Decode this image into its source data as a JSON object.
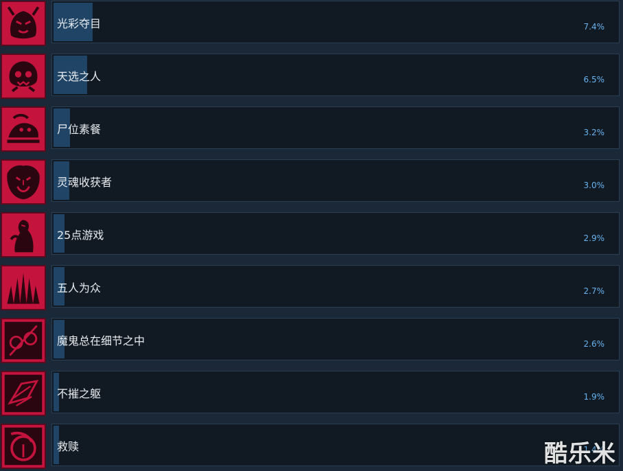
{
  "achievements": [
    {
      "name": "光彩夺目",
      "percent_label": "7.4%",
      "percent": 7.4,
      "icon": "demon-face-icon"
    },
    {
      "name": "天选之人",
      "percent_label": "6.5%",
      "percent": 6.5,
      "icon": "skull-flames-icon"
    },
    {
      "name": "尸位素餐",
      "percent_label": "3.2%",
      "percent": 3.2,
      "icon": "feast-creature-icon"
    },
    {
      "name": "灵魂收获者",
      "percent_label": "3.0%",
      "percent": 3.0,
      "icon": "reaper-face-icon"
    },
    {
      "name": "25点游戏",
      "percent_label": "2.9%",
      "percent": 2.9,
      "icon": "silhouette-figure-icon"
    },
    {
      "name": "五人为众",
      "percent_label": "2.7%",
      "percent": 2.7,
      "icon": "hands-rising-icon"
    },
    {
      "name": "魔鬼总在细节之中",
      "percent_label": "2.6%",
      "percent": 2.6,
      "icon": "glasses-scribble-icon"
    },
    {
      "name": "不摧之躯",
      "percent_label": "1.9%",
      "percent": 1.9,
      "icon": "armor-shard-icon"
    },
    {
      "name": "救赎",
      "percent_label": "1.4%",
      "percent": 1.4,
      "icon": "scythe-circle-icon"
    }
  ],
  "watermark": "酷乐米",
  "colors": {
    "icon_red": "#c4133c",
    "bar_fill": "#1f4466",
    "percent_text": "#68b3f0",
    "panel_bg": "#111a23"
  }
}
